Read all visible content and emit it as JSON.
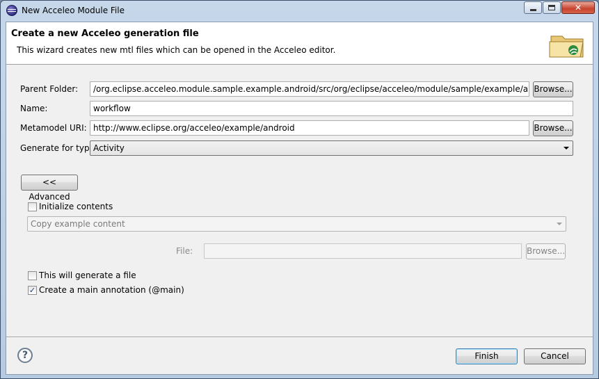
{
  "window": {
    "title": "New Acceleo Module File",
    "close_glyph": "✕"
  },
  "banner": {
    "title": "Create a new Acceleo generation file",
    "description": "This wizard creates new mtl files which can be opened in the Acceleo editor.",
    "icon": "folder-wizard-icon"
  },
  "form": {
    "parent_folder_label": "Parent Folder:",
    "parent_folder_value": "/org.eclipse.acceleo.module.sample.example.android/src/org/eclipse/acceleo/module/sample/example/android/files",
    "name_label": "Name:",
    "name_value": "workflow",
    "metamodel_label": "Metamodel URI:",
    "metamodel_value": "http://www.eclipse.org/acceleo/example/android",
    "type_label": "Generate for type:",
    "type_value": "Activity",
    "browse_label": "Browse..."
  },
  "advanced": {
    "toggle_label": "<< Advanced",
    "init_contents_label": "Initialize contents",
    "init_contents_checked": false,
    "copy_select_value": "Copy example content",
    "file_label": "File:",
    "file_value": "",
    "file_browse_label": "Browse...",
    "generate_file_label": "This will generate a file",
    "generate_file_checked": false,
    "main_annotation_label": "Create a main annotation (@main)",
    "main_annotation_checked": true,
    "check_glyph": "✓"
  },
  "footer": {
    "help_glyph": "?",
    "finish_label": "Finish",
    "cancel_label": "Cancel"
  }
}
